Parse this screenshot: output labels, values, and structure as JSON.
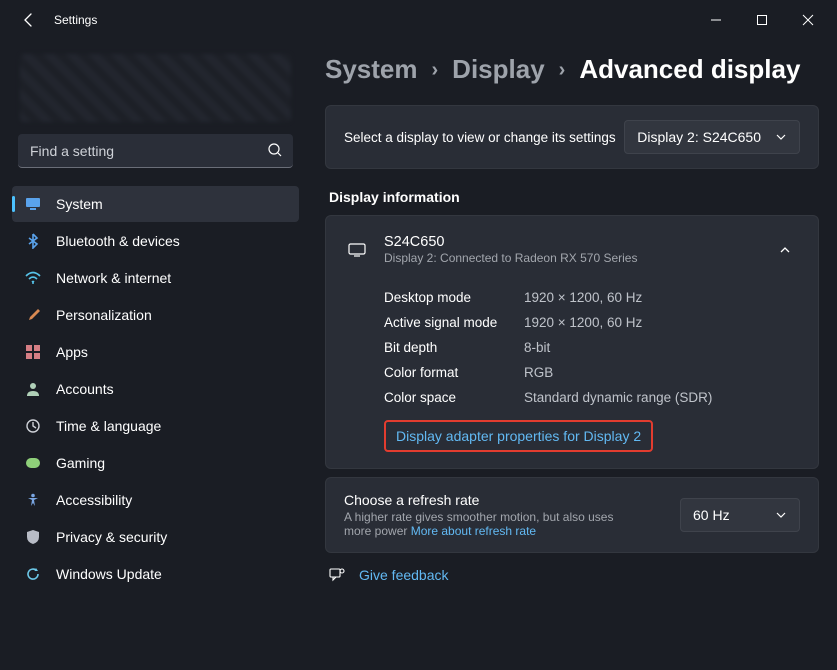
{
  "window": {
    "title": "Settings"
  },
  "search": {
    "placeholder": "Find a setting"
  },
  "sidebar": {
    "items": [
      {
        "label": "System",
        "active": true,
        "icon": "display",
        "color": "#5aa3ec"
      },
      {
        "label": "Bluetooth & devices",
        "active": false,
        "icon": "bluetooth",
        "color": "#5aa3ec"
      },
      {
        "label": "Network & internet",
        "active": false,
        "icon": "wifi",
        "color": "#56c2e8"
      },
      {
        "label": "Personalization",
        "active": false,
        "icon": "brush",
        "color": "#d98a52"
      },
      {
        "label": "Apps",
        "active": false,
        "icon": "apps",
        "color": "#d57e84"
      },
      {
        "label": "Accounts",
        "active": false,
        "icon": "user",
        "color": "#b0d0b8"
      },
      {
        "label": "Time & language",
        "active": false,
        "icon": "clock",
        "color": "#cfd2d8"
      },
      {
        "label": "Gaming",
        "active": false,
        "icon": "gaming",
        "color": "#8fd07a"
      },
      {
        "label": "Accessibility",
        "active": false,
        "icon": "accessibility",
        "color": "#7aa6e2"
      },
      {
        "label": "Privacy & security",
        "active": false,
        "icon": "shield",
        "color": "#b8bcc6"
      },
      {
        "label": "Windows Update",
        "active": false,
        "icon": "update",
        "color": "#6cc8e8"
      }
    ]
  },
  "breadcrumb": {
    "items": [
      "System",
      "Display",
      "Advanced display"
    ]
  },
  "selectDisplay": {
    "text": "Select a display to view or change its settings",
    "selected": "Display 2: S24C650"
  },
  "section": {
    "title": "Display information"
  },
  "displayInfo": {
    "name": "S24C650",
    "sub": "Display 2: Connected to Radeon RX 570 Series",
    "rows": [
      {
        "k": "Desktop mode",
        "v": "1920 × 1200, 60 Hz"
      },
      {
        "k": "Active signal mode",
        "v": "1920 × 1200, 60 Hz"
      },
      {
        "k": "Bit depth",
        "v": "8-bit"
      },
      {
        "k": "Color format",
        "v": "RGB"
      },
      {
        "k": "Color space",
        "v": "Standard dynamic range (SDR)"
      }
    ],
    "adapterLink": "Display adapter properties for Display 2"
  },
  "refresh": {
    "title": "Choose a refresh rate",
    "sub": "A higher rate gives smoother motion, but also uses more power  ",
    "link": "More about refresh rate",
    "selected": "60 Hz"
  },
  "feedback": {
    "label": "Give feedback"
  }
}
